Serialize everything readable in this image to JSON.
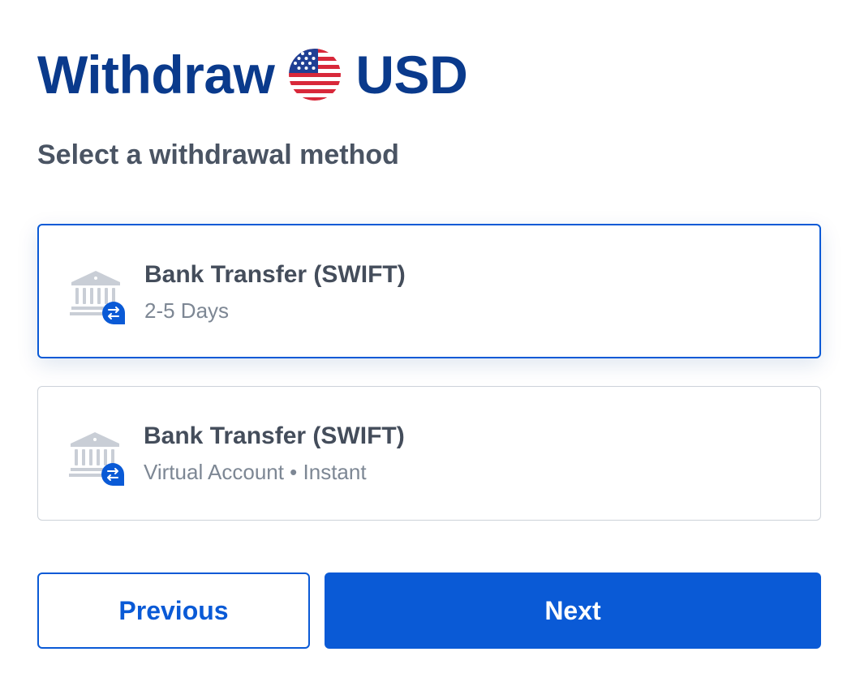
{
  "header": {
    "title_prefix": "Withdraw",
    "currency": "USD",
    "flag_icon": "us-flag-icon"
  },
  "subtitle": "Select a withdrawal method",
  "methods": [
    {
      "title": "Bank Transfer (SWIFT)",
      "detail": "2-5 Days",
      "icon": "bank-transfer-icon",
      "selected": true
    },
    {
      "title": "Bank Transfer (SWIFT)",
      "detail": "Virtual Account • Instant",
      "icon": "bank-transfer-icon",
      "selected": false
    }
  ],
  "buttons": {
    "previous": "Previous",
    "next": "Next"
  },
  "colors": {
    "brand_blue": "#0a5ad6",
    "title_navy": "#0a3a8c",
    "text_gray": "#444d5b",
    "muted_gray": "#7d8794"
  }
}
